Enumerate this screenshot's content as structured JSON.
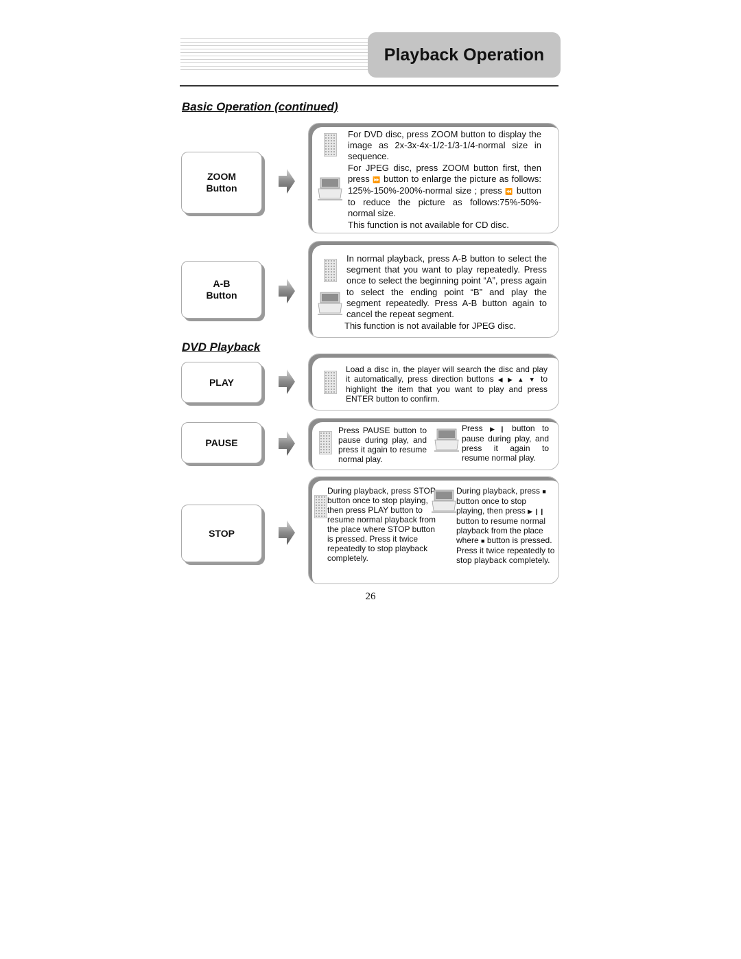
{
  "header": {
    "title": "Playback Operation"
  },
  "sections": {
    "basic": "Basic Operation (continued)",
    "dvd": "DVD Playback"
  },
  "buttons": {
    "zoom": {
      "line1": "ZOOM",
      "line2": "Button"
    },
    "ab": {
      "line1": "A-B",
      "line2": "Button"
    },
    "play": {
      "label": "PLAY"
    },
    "pause": {
      "label": "PAUSE"
    },
    "stop": {
      "label": "STOP"
    }
  },
  "panels": {
    "zoom": {
      "dvd_text": "For DVD disc, press ZOOM button to display the image as 2x-3x-4x-1/2-1/3-1/4-normal size in sequence.",
      "jpeg_pre": "For JPEG disc, press ZOOM button first, then press",
      "jpeg_mid": "button to enlarge the picture as follows: 125%-150%-200%-normal size ; press",
      "jpeg_post": "button to reduce the picture as follows:75%-50%-normal size.",
      "note": "This function is not available for CD disc.",
      "fwd_glyph": "⏩",
      "rev_glyph": "⏪"
    },
    "ab": {
      "text": "In normal playback, press A-B button to select the segment that you want to play repeatedly. Press once to select the beginning point “A”, press again to select the ending point “B” and play the segment repeatedly. Press A-B button again to cancel the repeat segment.",
      "note": "This function is not available for JPEG disc."
    },
    "play": {
      "pre": "Load a disc in, the player will search the disc and play it automatically, press direction buttons",
      "dirs": "◀ ▶ ▲ ▼",
      "post": "to highlight the item that you want to play and press ENTER button to confirm."
    },
    "pause": {
      "remote_text": "Press PAUSE button to pause during play, and press it again to resume normal play.",
      "player_pre": "Press",
      "player_glyph": "▶❙",
      "player_post": "button to pause during play, and press it again to resume normal play."
    },
    "stop": {
      "remote_text": "During playback, press STOP button once to stop playing, then press PLAY button to resume normal playback from the place where STOP button is pressed. Press it twice repeatedly to stop playback completely.",
      "player_l1": "During playback, press",
      "stop_glyph": "■",
      "player_l2": "button once to stop playing, then press",
      "playpause_glyph": "▶ ❙❙",
      "player_l3": "button to resume normal playback from the place where",
      "player_l4": "button is pressed. Press it twice repeatedly to stop playback completely."
    }
  },
  "footer": {
    "page_number": "26"
  }
}
